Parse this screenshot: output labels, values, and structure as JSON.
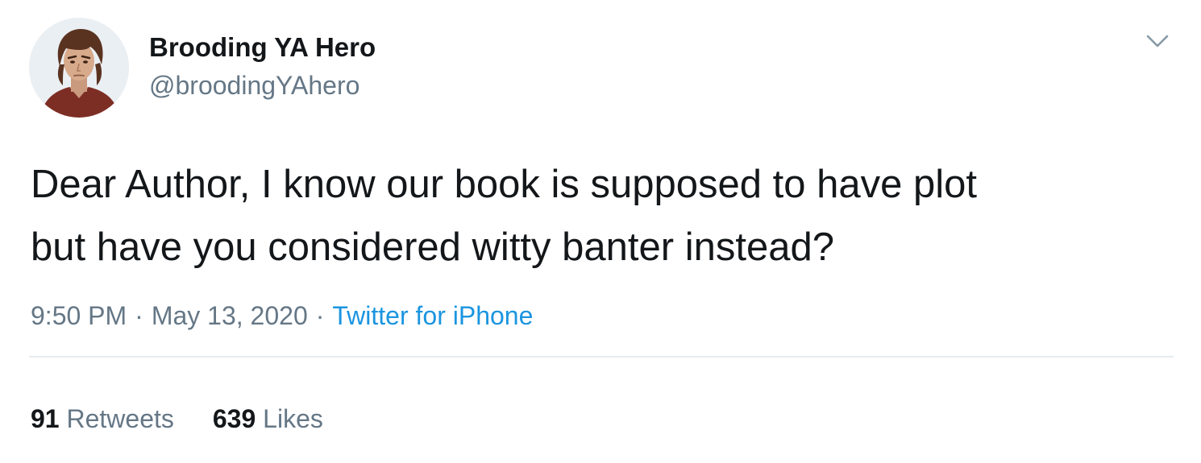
{
  "author": {
    "display_name": "Brooding YA Hero",
    "handle": "@broodingYAhero",
    "avatar_icon": "illustrated-portrait-avatar"
  },
  "tweet": {
    "text": "Dear Author, I know our book is supposed to have plot\nbut have you considered witty banter instead?",
    "time": "9:50 PM",
    "date": "May 13, 2020",
    "separator": "·",
    "source": "Twitter for iPhone"
  },
  "stats": {
    "retweets_count": "91",
    "retweets_label": "Retweets",
    "likes_count": "639",
    "likes_label": "Likes"
  },
  "icons": {
    "caret": "chevron-down-icon"
  },
  "colors": {
    "text": "#14171a",
    "secondary": "#657786",
    "link": "#1b95e0",
    "divider": "#e6ecf0"
  }
}
